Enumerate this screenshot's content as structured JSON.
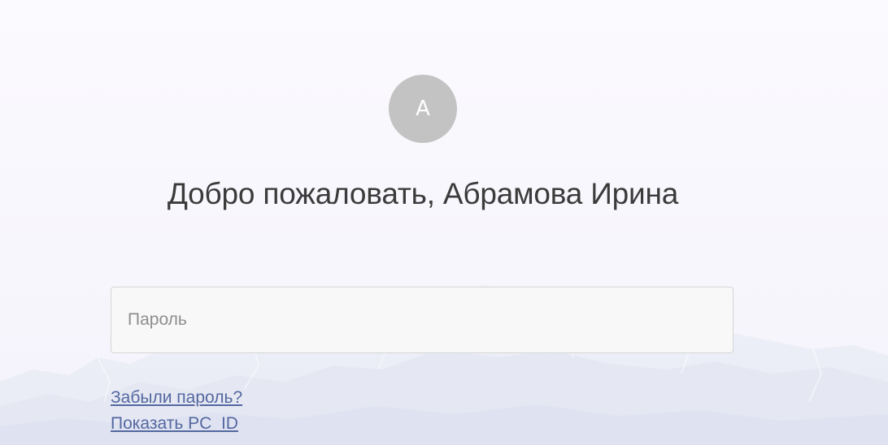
{
  "login": {
    "avatar_initial": "A",
    "welcome_text": "Добро пожаловать, Абрамова Ирина",
    "password_placeholder": "Пароль",
    "forgot_password_link": "Забыли пароль?",
    "show_pcid_link": "Показать PC_ID"
  },
  "colors": {
    "background": "#fbfafe",
    "avatar_bg": "#c3c3c3",
    "link": "#5468a0",
    "heading": "#3b3b3b"
  }
}
